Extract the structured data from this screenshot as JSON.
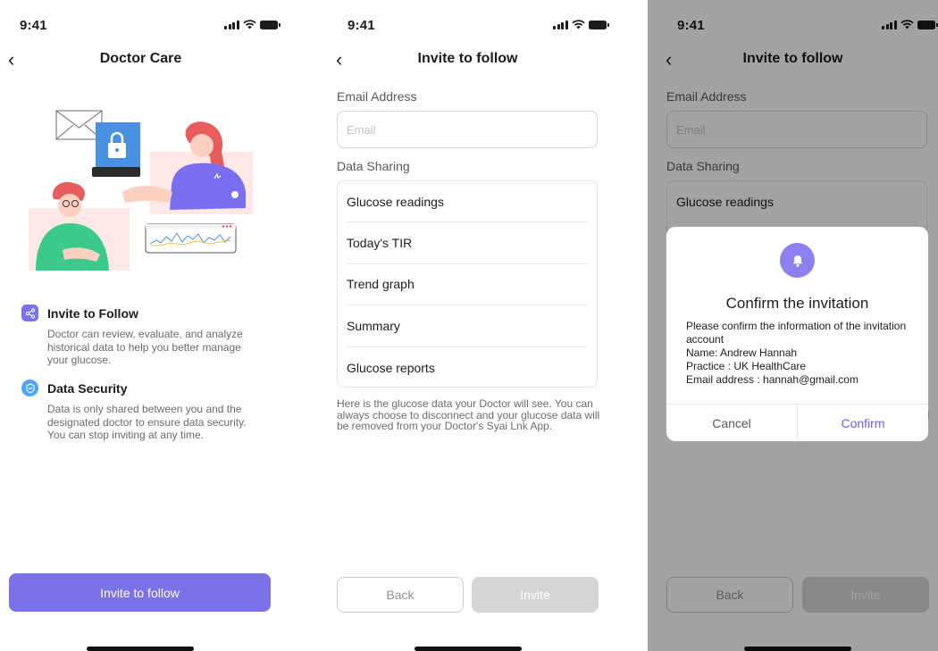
{
  "status": {
    "time": "9:41"
  },
  "doctor_care": {
    "title": "Doctor Care",
    "features": [
      {
        "icon": "share-icon",
        "title": "Invite to Follow",
        "desc": "Doctor can review, evaluate, and analyze historical data to help you better manage your glucose."
      },
      {
        "icon": "shield-icon",
        "title": "Data Security",
        "desc": "Data is only shared between you and the designated doctor to ensure data security. You can stop inviting at any time."
      }
    ],
    "button": "Invite to follow"
  },
  "invite": {
    "title": "Invite to follow",
    "email_label": "Email Address",
    "email_placeholder": "Email",
    "sharing_label": "Data Sharing",
    "items": [
      "Glucose readings",
      "Today's TIR",
      "Trend graph",
      "Summary",
      "Glucose reports"
    ],
    "note": "Here is the glucose data your Doctor will see. You can always choose to disconnect and your glucose data will be removed from your Doctor's  Syai Lnk App.",
    "back_label": "Back",
    "invite_label": "Invite"
  },
  "confirm_dialog": {
    "icon": "bell-icon",
    "title": "Confirm the invitation",
    "line1": "Please confirm the information of the invitation account",
    "name": "Name: Andrew Hannah",
    "practice": "Practice : UK HealthCare",
    "email": "Email address : hannah@gmail.com",
    "cancel": "Cancel",
    "confirm": "Confirm"
  },
  "colors": {
    "accent": "#7b72ea",
    "disabled_button": "#d5d5d7",
    "dialog_icon": "#8b80ee",
    "confirm_text": "#6c63e0"
  }
}
